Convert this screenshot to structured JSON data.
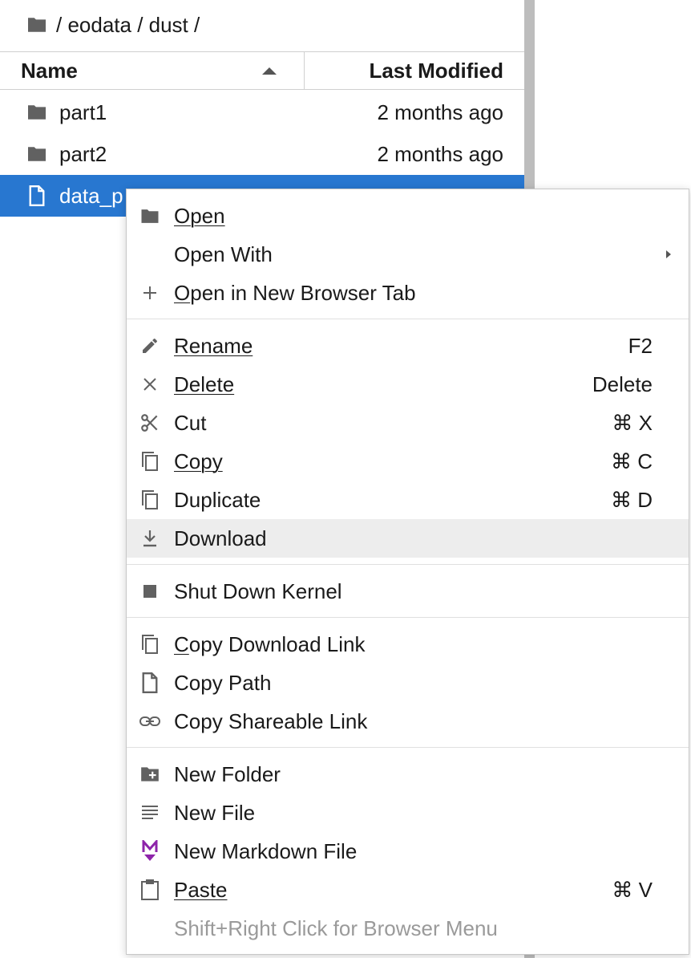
{
  "breadcrumb": {
    "path": "/ eodata / dust /"
  },
  "listing": {
    "columns": {
      "name": "Name",
      "modified": "Last Modified"
    },
    "items": [
      {
        "name": "part1",
        "modified": "2 months ago",
        "type": "folder"
      },
      {
        "name": "part2",
        "modified": "2 months ago",
        "type": "folder"
      },
      {
        "name": "data_p",
        "modified": "",
        "type": "file",
        "selected": true
      }
    ]
  },
  "context_menu": {
    "open": "Open",
    "open_with": "Open With",
    "open_new_tab": "Open in New Browser Tab",
    "rename": "Rename",
    "rename_shortcut": "F2",
    "delete": "Delete",
    "delete_shortcut": "Delete",
    "cut": "Cut",
    "cut_shortcut": "⌘ X",
    "copy": "Copy",
    "copy_shortcut": "⌘ C",
    "duplicate": "Duplicate",
    "duplicate_shortcut": "⌘ D",
    "download": "Download",
    "shutdown_kernel": "Shut Down Kernel",
    "copy_download_link": "Copy Download Link",
    "copy_path": "Copy Path",
    "copy_shareable_link": "Copy Shareable Link",
    "new_folder": "New Folder",
    "new_file": "New File",
    "new_markdown_file": "New Markdown File",
    "paste": "Paste",
    "paste_shortcut": "⌘ V",
    "browser_menu_hint": "Shift+Right Click for Browser Menu"
  },
  "colors": {
    "selection": "#2877d0",
    "hover": "#ededed",
    "markdown_icon": "#8e24aa",
    "icon": "#616161"
  }
}
